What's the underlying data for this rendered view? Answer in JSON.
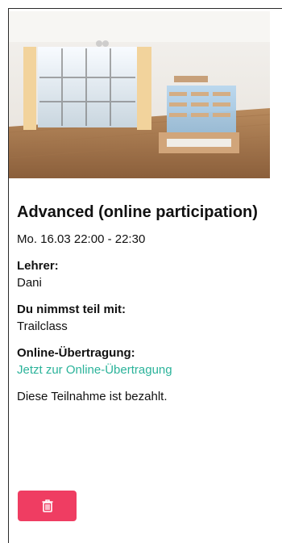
{
  "photo": {
    "icon": "studio-photo-icon",
    "alt": ""
  },
  "course": {
    "title": "Advanced (online participation)",
    "datetime": "Mo. 16.03 22:00 - 22:30",
    "teacher_label": "Lehrer:",
    "teacher": "Dani",
    "participation_label": "Du nimmst teil mit:",
    "participation": "Trailclass",
    "online_label": "Online-Übertragung:",
    "online_link": "Jetzt zur Online-Übertragung",
    "payment_status": "Diese Teilnahme ist bezahlt."
  },
  "actions": {
    "delete_icon": "trash-icon",
    "delete_color": "#ef3d62"
  },
  "colors": {
    "accent_link": "#2bb39a"
  }
}
